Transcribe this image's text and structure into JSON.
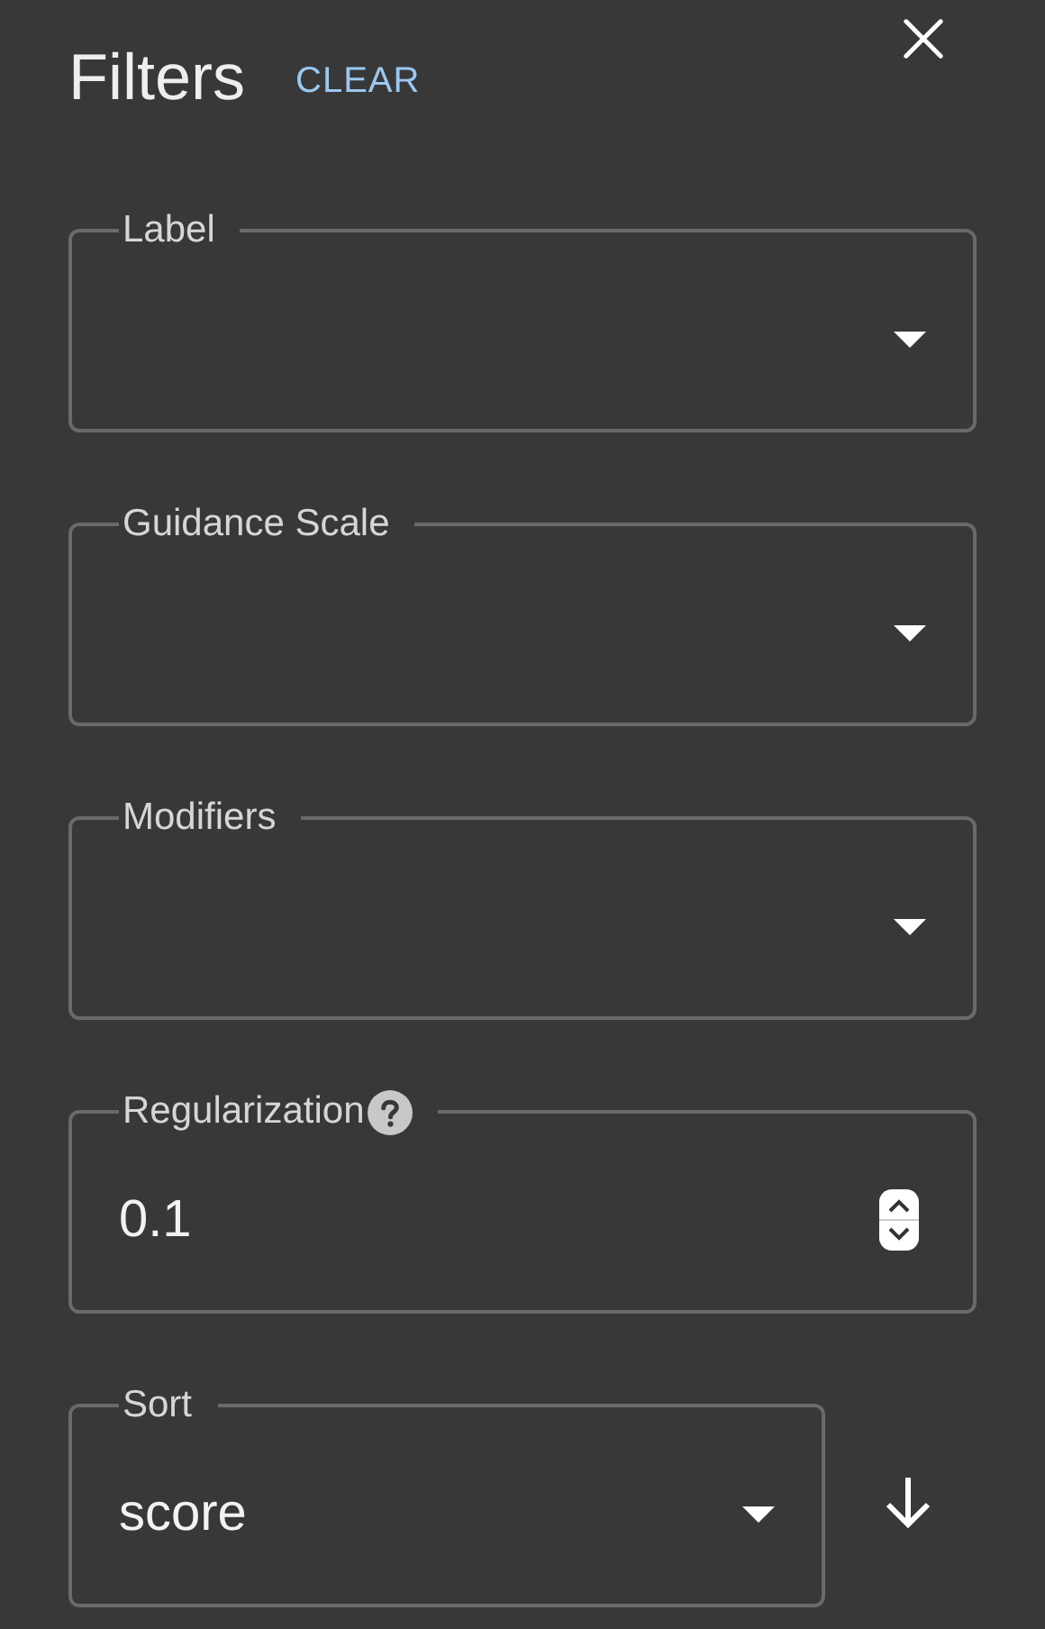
{
  "header": {
    "title": "Filters",
    "clear": "CLEAR"
  },
  "fields": [
    {
      "kind": "select",
      "label": "Label"
    },
    {
      "kind": "select",
      "label": "Guidance Scale"
    },
    {
      "kind": "select",
      "label": "Modifiers"
    },
    {
      "kind": "number",
      "label": "Regularization",
      "help": true,
      "value": "0.1"
    },
    {
      "kind": "select",
      "label": "Sort",
      "value": "score",
      "descending": true
    }
  ]
}
